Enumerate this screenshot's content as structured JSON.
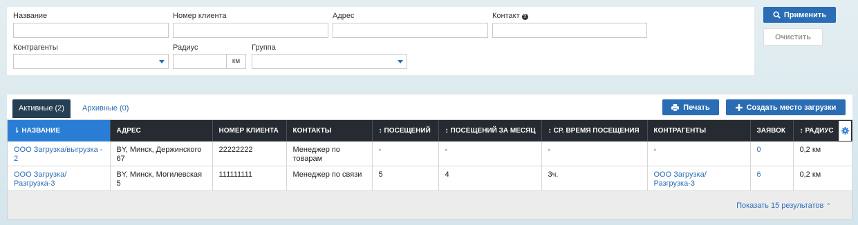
{
  "filters": {
    "name_label": "Название",
    "client_no_label": "Номер клиента",
    "address_label": "Адрес",
    "contact_label": "Контакт",
    "counterparties_label": "Контрагенты",
    "radius_label": "Радиус",
    "radius_unit": "км",
    "group_label": "Группа",
    "apply_label": "Применить",
    "clear_label": "Очистить"
  },
  "tabs": [
    {
      "label": "Активные (2)",
      "active": true
    },
    {
      "label": "Архивные (0)",
      "active": false
    }
  ],
  "actions": {
    "print_label": "Печать",
    "create_label": "Создать место загрузки"
  },
  "table": {
    "columns": [
      "Название",
      "Адрес",
      "Номер клиента",
      "Контакты",
      "Посещений",
      "Посещений за месяц",
      "Ср. время посещения",
      "Контрагенты",
      "Заявок",
      "Радиус"
    ],
    "rows": [
      {
        "name": "ООО Загрузка/выгрузка - 2",
        "address": "BY, Минск, Держинского 67",
        "client_no": "22222222",
        "contacts": "Менеджер по товарам",
        "visits": "-",
        "visits_month": "-",
        "avg_time": "-",
        "counterparties": "-",
        "requests": "0",
        "radius": "0,2 км"
      },
      {
        "name": "ООО Загрузка/ Разгрузка-3",
        "address": "BY, Минск, Могилевская 5",
        "client_no": "111111111",
        "contacts": "Менеджер по связи",
        "visits": "5",
        "visits_month": "4",
        "avg_time": "3ч.",
        "counterparties": "ООО Загрузка/ Разгрузка-3",
        "requests": "6",
        "radius": "0,2 км"
      }
    ],
    "show_more": "Показать 15 результатов"
  },
  "colors": {
    "accent": "#2a6db5",
    "header_dark": "#252b31",
    "tab_active": "#253f54",
    "sorted_header": "#2a7dd4"
  }
}
